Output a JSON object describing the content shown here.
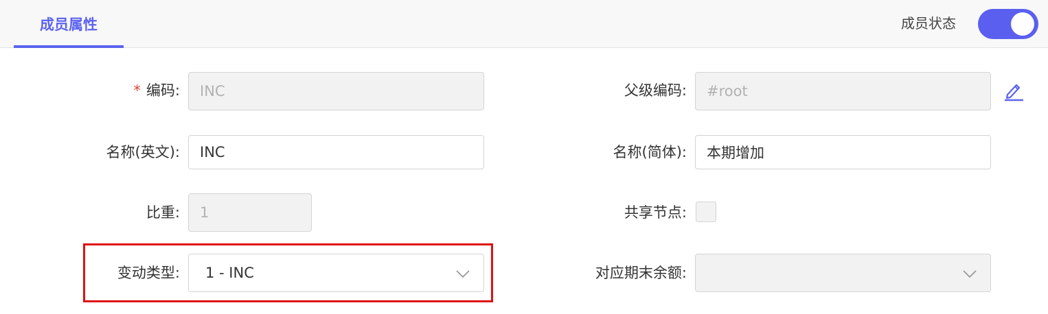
{
  "tabs": [
    {
      "label": "成员属性"
    }
  ],
  "header": {
    "status_label": "成员状态",
    "status_on": true
  },
  "form": {
    "code": {
      "label": "编码",
      "required_mark": "*",
      "value": "INC"
    },
    "parent_code": {
      "label": "父级编码",
      "value": "#root"
    },
    "name_en": {
      "label": "名称(英文)",
      "value": "INC"
    },
    "name_cn": {
      "label": "名称(简体)",
      "value": "本期增加"
    },
    "weight": {
      "label": "比重",
      "value": "1"
    },
    "shared_node": {
      "label": "共享节点",
      "checked": false
    },
    "change_type": {
      "label": "变动类型",
      "value": "1 - INC"
    },
    "closing_balance": {
      "label": "对应期末余额",
      "value": ""
    }
  },
  "colon": ":",
  "icons": {
    "edit": "pencil-icon",
    "dropdown": "chevron-down-icon"
  },
  "colors": {
    "accent": "#5b63ee",
    "toggle": "#5a5ff0",
    "required": "#e0403c",
    "highlight": "#e01010"
  }
}
